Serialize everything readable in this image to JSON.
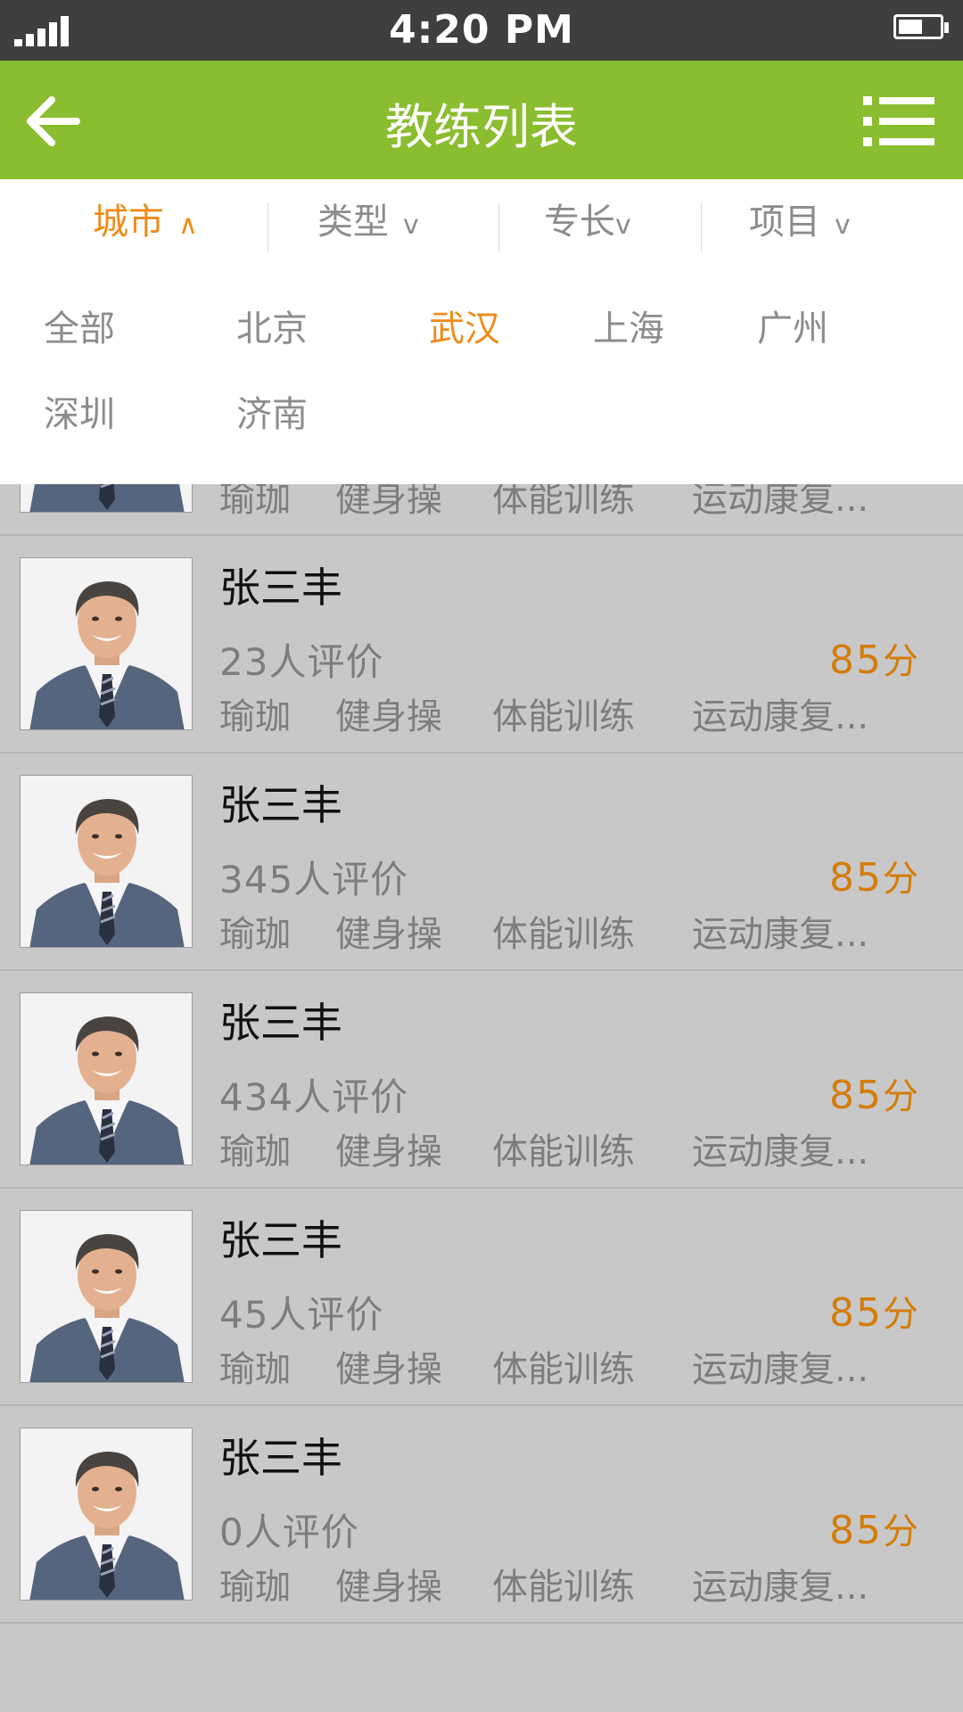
{
  "status_bar": {
    "time": "4:20 PM"
  },
  "header": {
    "title": "教练列表"
  },
  "filters": [
    {
      "label": "城市",
      "arrow": "∧",
      "active": true
    },
    {
      "label": "类型",
      "arrow": "v",
      "active": false
    },
    {
      "label": "专长",
      "arrow": "v",
      "active": false
    },
    {
      "label": "项目",
      "arrow": "v",
      "active": false
    }
  ],
  "cities": [
    "全部",
    "北京",
    "武汉",
    "上海",
    "广州",
    "深圳",
    "济南"
  ],
  "selected_city": "武汉",
  "partial_row": {
    "tags": [
      "瑜珈",
      "健身操",
      "体能训练",
      "运动康复..."
    ]
  },
  "coaches": [
    {
      "name": "张三丰",
      "reviews": "23人评价",
      "score": "85",
      "score_unit": "分",
      "tags": [
        "瑜珈",
        "健身操",
        "体能训练",
        "运动康复..."
      ]
    },
    {
      "name": "张三丰",
      "reviews": "345人评价",
      "score": "85",
      "score_unit": "分",
      "tags": [
        "瑜珈",
        "健身操",
        "体能训练",
        "运动康复..."
      ]
    },
    {
      "name": "张三丰",
      "reviews": "434人评价",
      "score": "85",
      "score_unit": "分",
      "tags": [
        "瑜珈",
        "健身操",
        "体能训练",
        "运动康复..."
      ]
    },
    {
      "name": "张三丰",
      "reviews": "45人评价",
      "score": "85",
      "score_unit": "分",
      "tags": [
        "瑜珈",
        "健身操",
        "体能训练",
        "运动康复..."
      ]
    },
    {
      "name": "张三丰",
      "reviews": "0人评价",
      "score": "85",
      "score_unit": "分",
      "tags": [
        "瑜珈",
        "健身操",
        "体能训练",
        "运动康复..."
      ]
    }
  ],
  "colors": {
    "header": "#8abd2f",
    "accent": "#ee8b17",
    "score": "#d47c0a",
    "overlay": "#c8c8c8"
  },
  "icons": {
    "back": "arrow-left-icon",
    "menu": "list-menu-icon"
  }
}
